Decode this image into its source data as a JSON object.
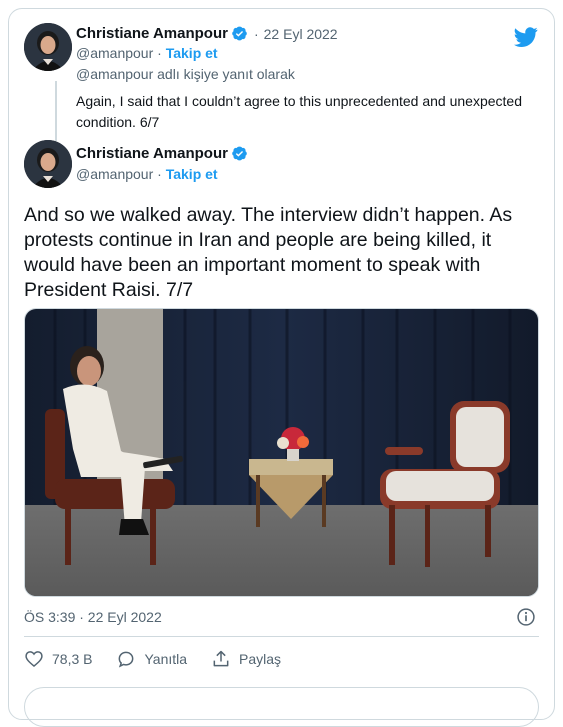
{
  "colors": {
    "accent": "#1d9bf0",
    "text": "#0f1419",
    "muted": "#536471",
    "border": "#cfd9de"
  },
  "reply_tweet": {
    "name": "Christiane Amanpour",
    "verified_icon": "verified-badge-icon",
    "date_sep": "·",
    "date": "22 Eyl 2022",
    "handle": "@amanpour",
    "handle_sep": "·",
    "follow_label": "Takip et",
    "reply_context": "@amanpour adlı kişiye yanıt olarak",
    "text": "Again, I said that I couldn’t agree to this unprecedented and unexpected condition. 6/7"
  },
  "main_tweet": {
    "name": "Christiane Amanpour",
    "handle": "@amanpour",
    "handle_sep": "·",
    "follow_label": "Takip et",
    "text": "And so we walked away. The interview didn’t happen. As protests continue in Iran and people are being killed, it would have been an important moment to speak with President Raisi. 7/7",
    "timestamp": "ÖS 3:39 · 22 Eyl 2022"
  },
  "actions": [
    {
      "icon": "heart-icon",
      "label": "78,3 B"
    },
    {
      "icon": "reply-icon",
      "label": "Yanıtla"
    },
    {
      "icon": "share-icon",
      "label": "Paylaş"
    }
  ]
}
